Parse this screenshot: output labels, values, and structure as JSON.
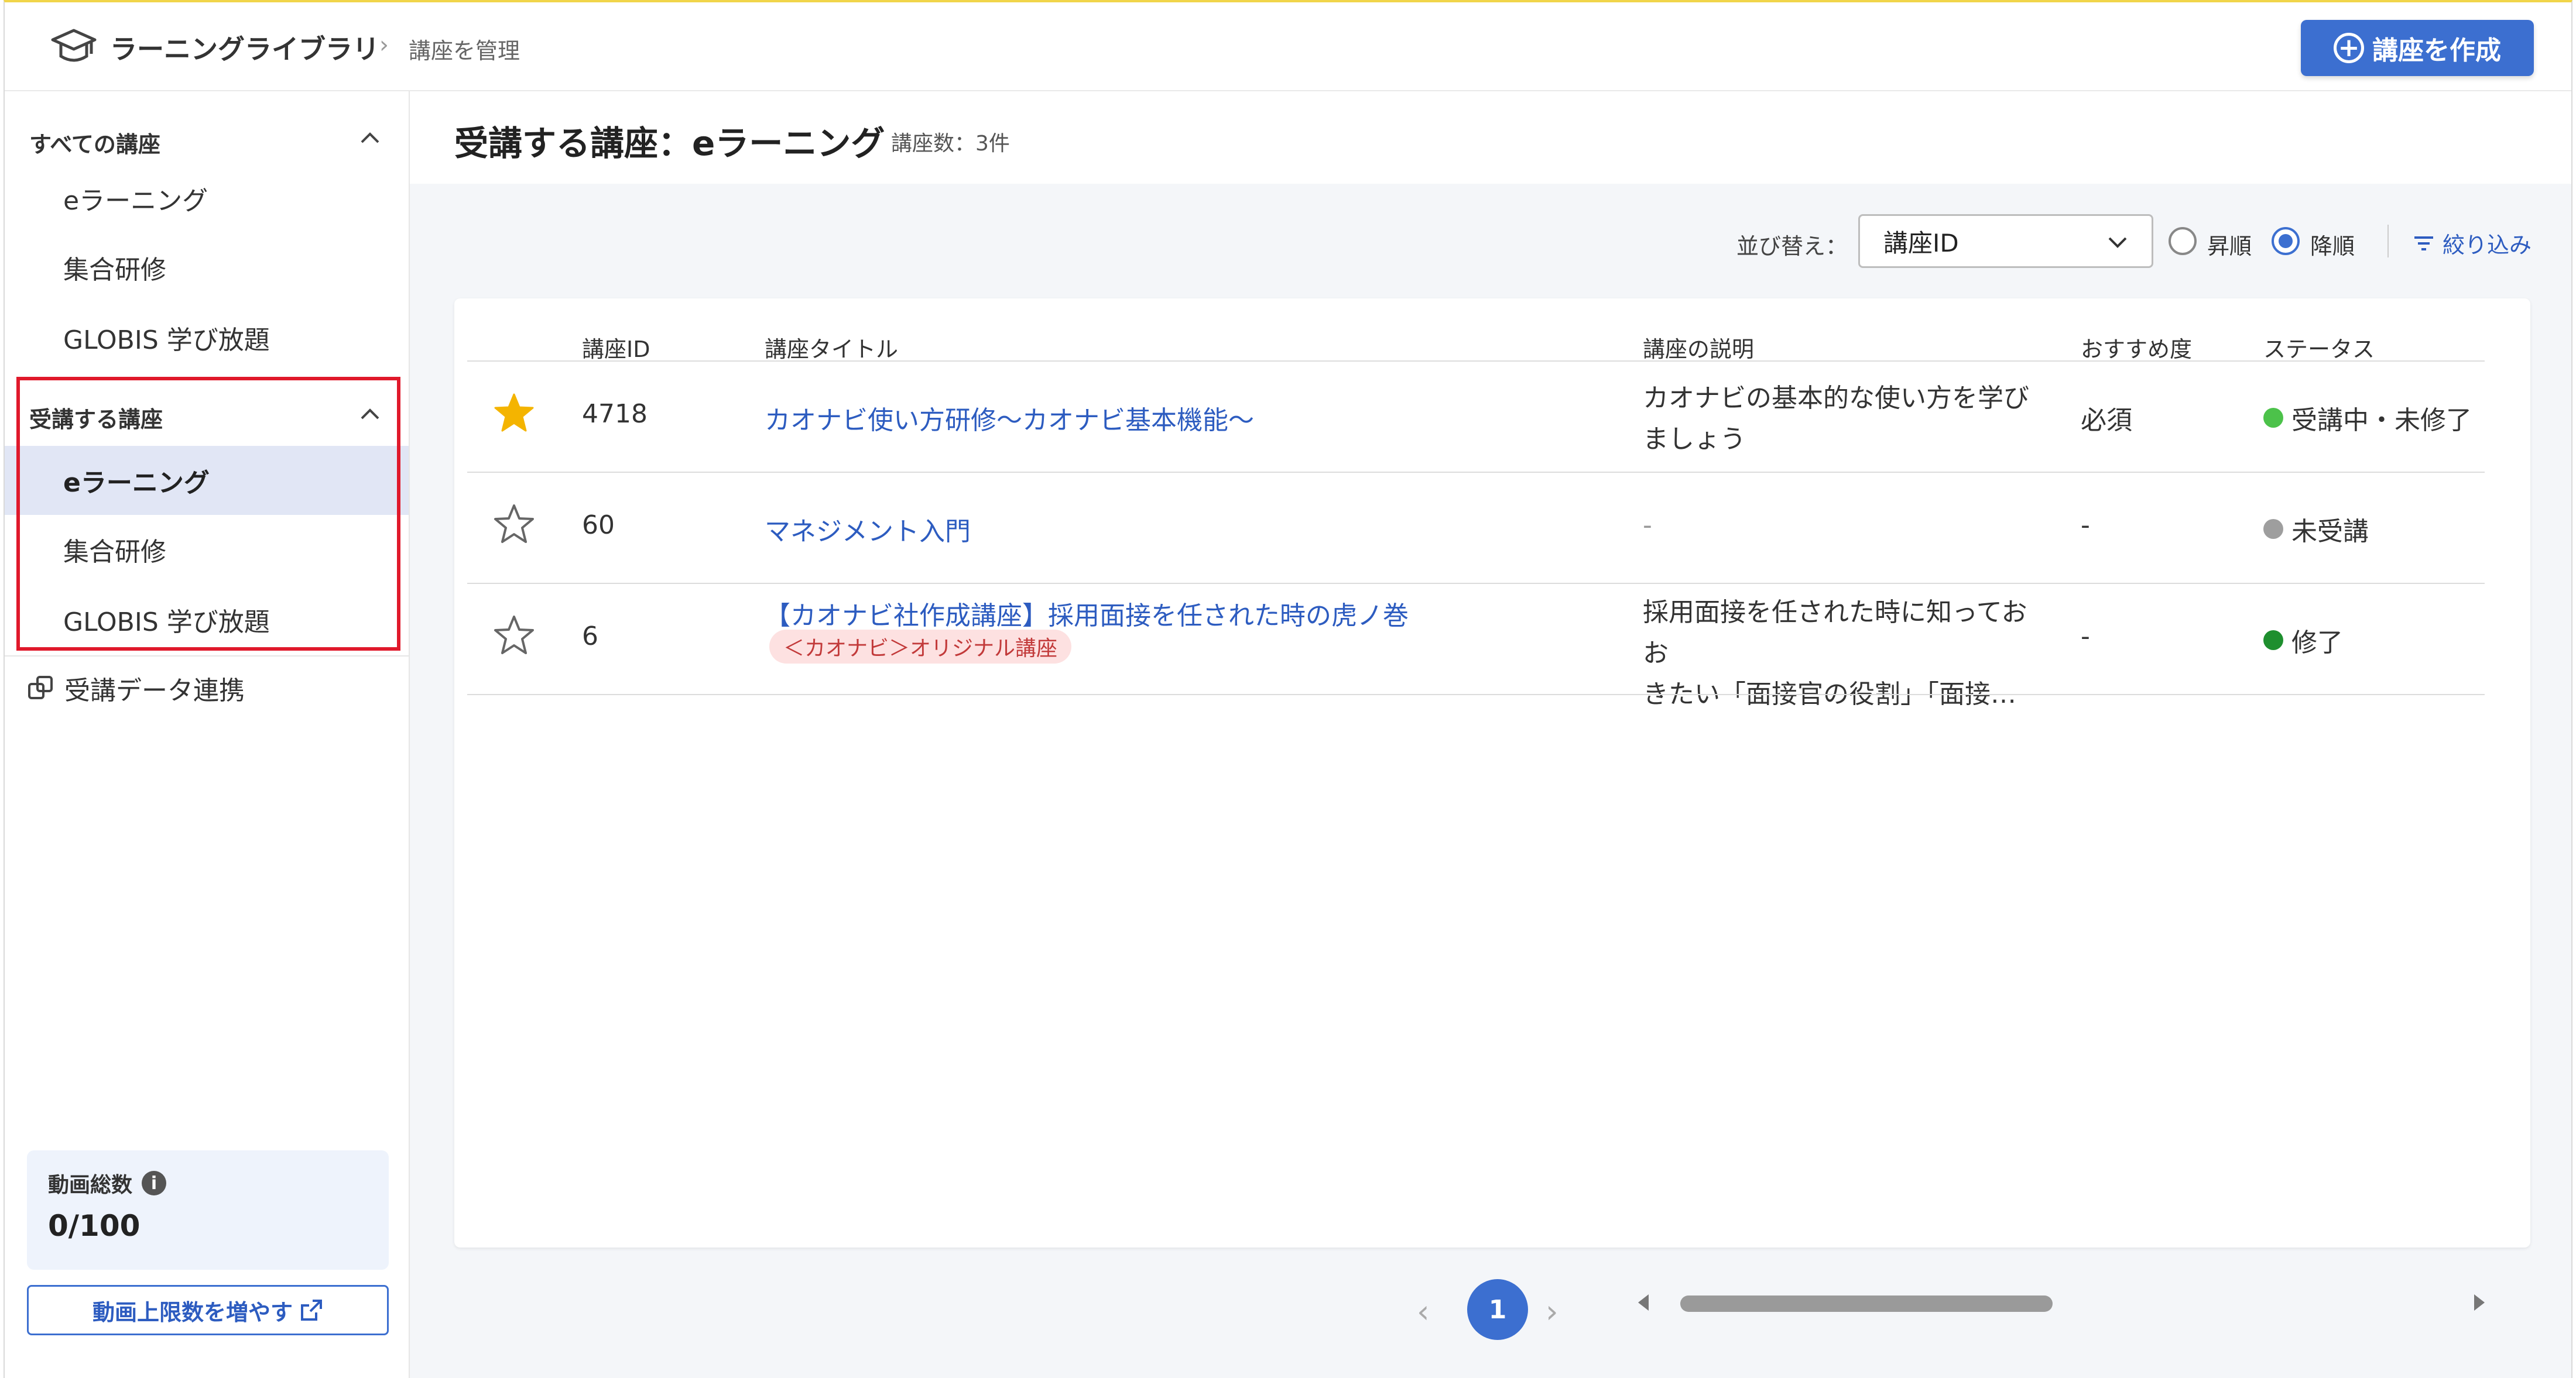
{
  "header": {
    "app_title": "ラーニングライブラリ",
    "breadcrumb_sep": "›",
    "breadcrumb": "講座を管理",
    "create_button": "講座を作成"
  },
  "sidebar": {
    "all_courses": {
      "label": "すべての講座",
      "items": [
        "eラーニング",
        "集合研修",
        "GLOBIS 学び放題"
      ]
    },
    "my_courses": {
      "label": "受講する講座",
      "items": [
        "eラーニング",
        "集合研修",
        "GLOBIS 学び放題"
      ],
      "active_index": 0
    },
    "data_sync": "受講データ連携",
    "video_total_label": "動画総数",
    "video_total_value": "0/100",
    "increase_button": "動画上限数を増やす"
  },
  "main": {
    "title": "受講する講座：eラーニング",
    "count": "講座数：3件",
    "sort_label": "並び替え：",
    "sort_value": "講座ID",
    "asc_label": "昇順",
    "desc_label": "降順",
    "sort_order": "desc",
    "filter_label": "絞り込み"
  },
  "table": {
    "columns": [
      "講座ID",
      "講座タイトル",
      "講座の説明",
      "おすすめ度",
      "ステータス"
    ],
    "rows": [
      {
        "starred": true,
        "id": "4718",
        "title": "カオナビ使い方研修〜カオナビ基本機能〜",
        "tag": "",
        "desc_line1": "カオナビの基本的な使い方を学び",
        "desc_line2": "ましょう",
        "recommend": "必須",
        "status": "受講中・未修了",
        "status_color": "#4cc24a"
      },
      {
        "starred": false,
        "id": "60",
        "title": "マネジメント入門",
        "tag": "",
        "desc_line1": "-",
        "desc_line2": "",
        "recommend": "-",
        "status": "未受講",
        "status_color": "#9e9e9e"
      },
      {
        "starred": false,
        "id": "6",
        "title": "【カオナビ社作成講座】採用面接を任された時の虎ノ巻",
        "tag": "＜カオナビ＞オリジナル講座",
        "desc_line1": "採用面接を任された時に知っておお",
        "desc_line2": "きたい「面接官の役割」「面接…",
        "recommend": "-",
        "status": "修了",
        "status_color": "#1e8f2e"
      }
    ]
  },
  "pagination": {
    "prev": "‹",
    "current": "1",
    "next": "›"
  },
  "colors": {
    "accent": "#3c6fd0",
    "highlight_border": "#e0192b",
    "star_filled": "#f4b400"
  }
}
